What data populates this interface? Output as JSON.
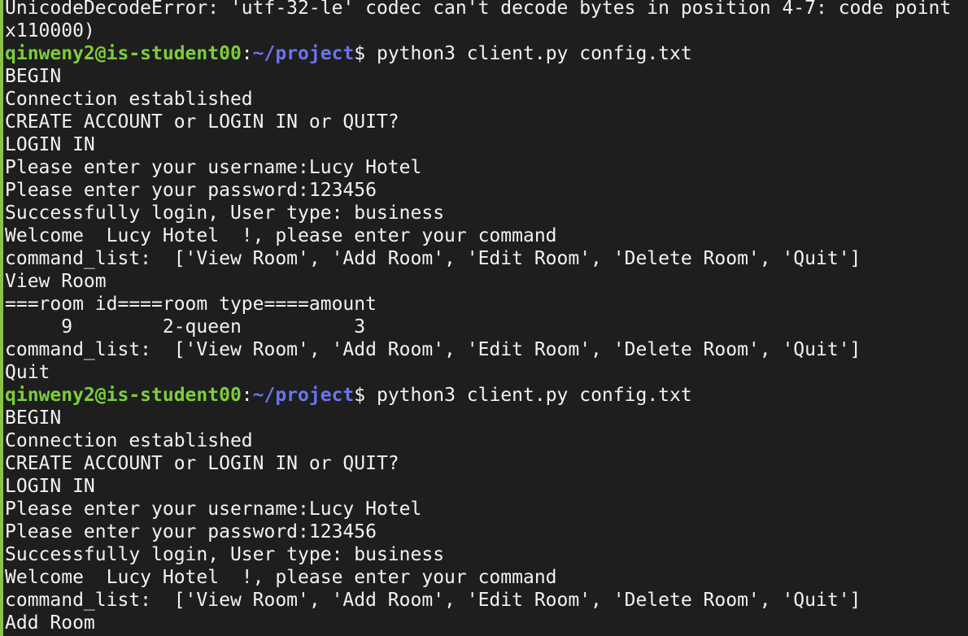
{
  "terminal": {
    "colors": {
      "background": "#1e1e1e",
      "text": "#f2f2f2",
      "prompt_user": "#7ccd3c",
      "prompt_path": "#6b73f0",
      "gutter": "#8bc34a"
    },
    "lines": [
      {
        "type": "text",
        "text": "UnicodeDecodeError: 'utf-32-le' codec can't decode bytes in position 4-7: code point"
      },
      {
        "type": "text",
        "text": "x110000)"
      },
      {
        "type": "prompt",
        "user": "qinweny2@is-student00",
        "sep": ":",
        "path": "~/project",
        "symbol": "$ ",
        "command": "python3 client.py config.txt"
      },
      {
        "type": "text",
        "text": "BEGIN"
      },
      {
        "type": "text",
        "text": "Connection established"
      },
      {
        "type": "text",
        "text": "CREATE ACCOUNT or LOGIN IN or QUIT?"
      },
      {
        "type": "text",
        "text": "LOGIN IN"
      },
      {
        "type": "text",
        "text": "Please enter your username:Lucy Hotel"
      },
      {
        "type": "text",
        "text": "Please enter your password:123456"
      },
      {
        "type": "text",
        "text": "Successfully login, User type: business"
      },
      {
        "type": "text",
        "text": "Welcome  Lucy Hotel  !, please enter your command"
      },
      {
        "type": "text",
        "text": "command_list:  ['View Room', 'Add Room', 'Edit Room', 'Delete Room', 'Quit']"
      },
      {
        "type": "text",
        "text": "View Room"
      },
      {
        "type": "text",
        "text": "===room id====room type====amount"
      },
      {
        "type": "text",
        "text": "     9        2-queen          3"
      },
      {
        "type": "text",
        "text": "command_list:  ['View Room', 'Add Room', 'Edit Room', 'Delete Room', 'Quit']"
      },
      {
        "type": "text",
        "text": "Quit"
      },
      {
        "type": "prompt",
        "user": "qinweny2@is-student00",
        "sep": ":",
        "path": "~/project",
        "symbol": "$ ",
        "command": "python3 client.py config.txt"
      },
      {
        "type": "text",
        "text": "BEGIN"
      },
      {
        "type": "text",
        "text": "Connection established"
      },
      {
        "type": "text",
        "text": "CREATE ACCOUNT or LOGIN IN or QUIT?"
      },
      {
        "type": "text",
        "text": "LOGIN IN"
      },
      {
        "type": "text",
        "text": "Please enter your username:Lucy Hotel"
      },
      {
        "type": "text",
        "text": "Please enter your password:123456"
      },
      {
        "type": "text",
        "text": "Successfully login, User type: business"
      },
      {
        "type": "text",
        "text": "Welcome  Lucy Hotel  !, please enter your command"
      },
      {
        "type": "text",
        "text": "command_list:  ['View Room', 'Add Room', 'Edit Room', 'Delete Room', 'Quit']"
      },
      {
        "type": "text",
        "text": "Add Room"
      }
    ]
  }
}
